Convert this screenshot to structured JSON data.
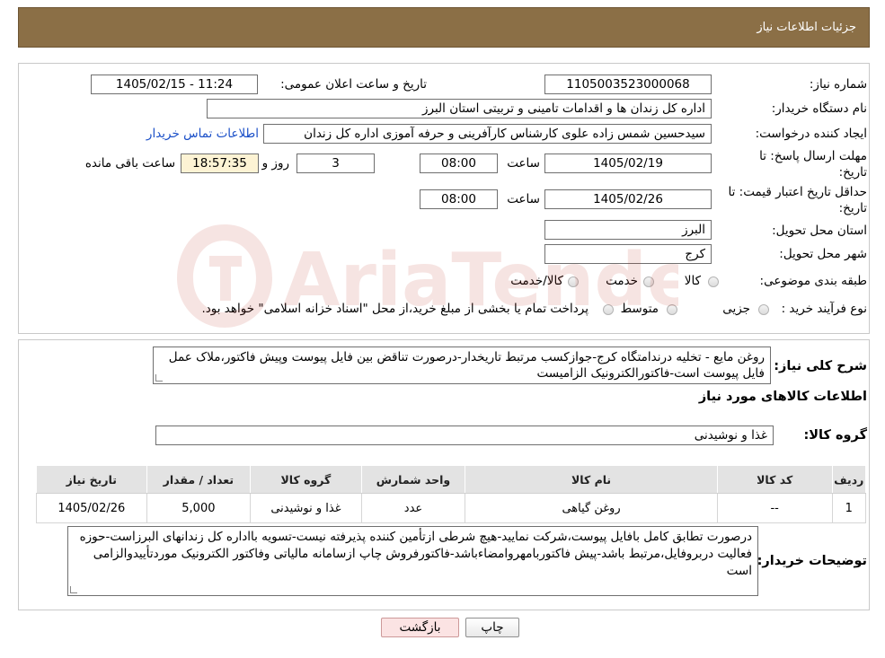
{
  "header": {
    "title": "جزئیات اطلاعات نیاز"
  },
  "form": {
    "need_number_label": "شماره نیاز:",
    "need_number": "1105003523000068",
    "announce_label": "تاریخ و ساعت اعلان عمومی:",
    "announce_value": "1405/02/15 - 11:24",
    "buyer_label": "نام دستگاه خریدار:",
    "buyer_value": "اداره کل زندان ها و اقدامات تامینی و تربیتی استان البرز",
    "creator_label": "ایجاد کننده درخواست:",
    "creator_value": "سیدحسین شمس زاده علوی کارشناس کارآفرینی و حرفه آموزی اداره کل زندان",
    "contact_link": "اطلاعات تماس خریدار",
    "deadline_label": "مهلت ارسال پاسخ: تا",
    "deadline_label2": "تاریخ:",
    "deadline_date": "1405/02/19",
    "time_label": "ساعت",
    "deadline_time": "08:00",
    "days_value": "3",
    "days_label": "روز و",
    "remaining_time": "18:57:35",
    "remaining_label": "ساعت باقی مانده",
    "validity_label": "حداقل تاریخ اعتبار قیمت: تا",
    "validity_label2": "تاریخ:",
    "validity_date": "1405/02/26",
    "validity_time": "08:00",
    "province_label": "استان محل تحویل:",
    "province_value": "البرز",
    "city_label": "شهر محل تحویل:",
    "city_value": "کرج",
    "category_label": "طبقه بندی موضوعی:",
    "category_options": [
      "کالا",
      "خدمت",
      "کالا/خدمت"
    ],
    "process_label": "نوع فرآیند خرید :",
    "process_options": [
      "جزیی",
      "متوسط"
    ],
    "process_note": "پرداخت تمام یا بخشی از مبلغ خرید،از محل \"اسناد خزانه اسلامی\" خواهد بود."
  },
  "details": {
    "summary_label": "شرح کلی نیاز:",
    "summary_text": "روغن مایع - تخلیه درندامتگاه کرج-جوازکسب مرتبط تاریخدار-درصورت تناقض بین فایل پیوست وپیش فاکتور،ملاک عمل فایل پیوست است-فاکتورالکترونیک الزامیست",
    "items_title": "اطلاعات کالاهای مورد نیاز",
    "group_label": "گروه کالا:",
    "group_value": "غذا و نوشیدنی",
    "table_headers": [
      "ردیف",
      "کد کالا",
      "نام کالا",
      "واحد شمارش",
      "گروه کالا",
      "تعداد / مقدار",
      "تاریخ نیاز"
    ],
    "table_rows": [
      [
        "1",
        "--",
        "روغن گیاهی",
        "عدد",
        "غذا و نوشیدنی",
        "5,000",
        "1405/02/26"
      ]
    ],
    "buyer_notes_label": "توضیحات خریدار:",
    "buyer_notes": "درصورت تطابق کامل بافایل پیوست،شرکت نمایید-هیچ شرطی ازتأمین کننده پذیرفته نیست-تسویه بااداره کل زندانهای البرزاست-حوزه فعالیت دربروفایل،مرتبط باشد-پیش فاکتوربامهروامضاءباشد-فاکتورفروش چاپ ازسامانه مالیاتی وفاکتور الکترونیک موردتأییدوالزامی است"
  },
  "buttons": {
    "print": "چاپ",
    "back": "بازگشت"
  },
  "watermark": {
    "text": "AriaTender.neT"
  },
  "colors": {
    "header_bg": "#8b6f46",
    "link": "#1a4fc8",
    "highlight": "#fdf3d4",
    "back_button": "#fbe3e3"
  }
}
